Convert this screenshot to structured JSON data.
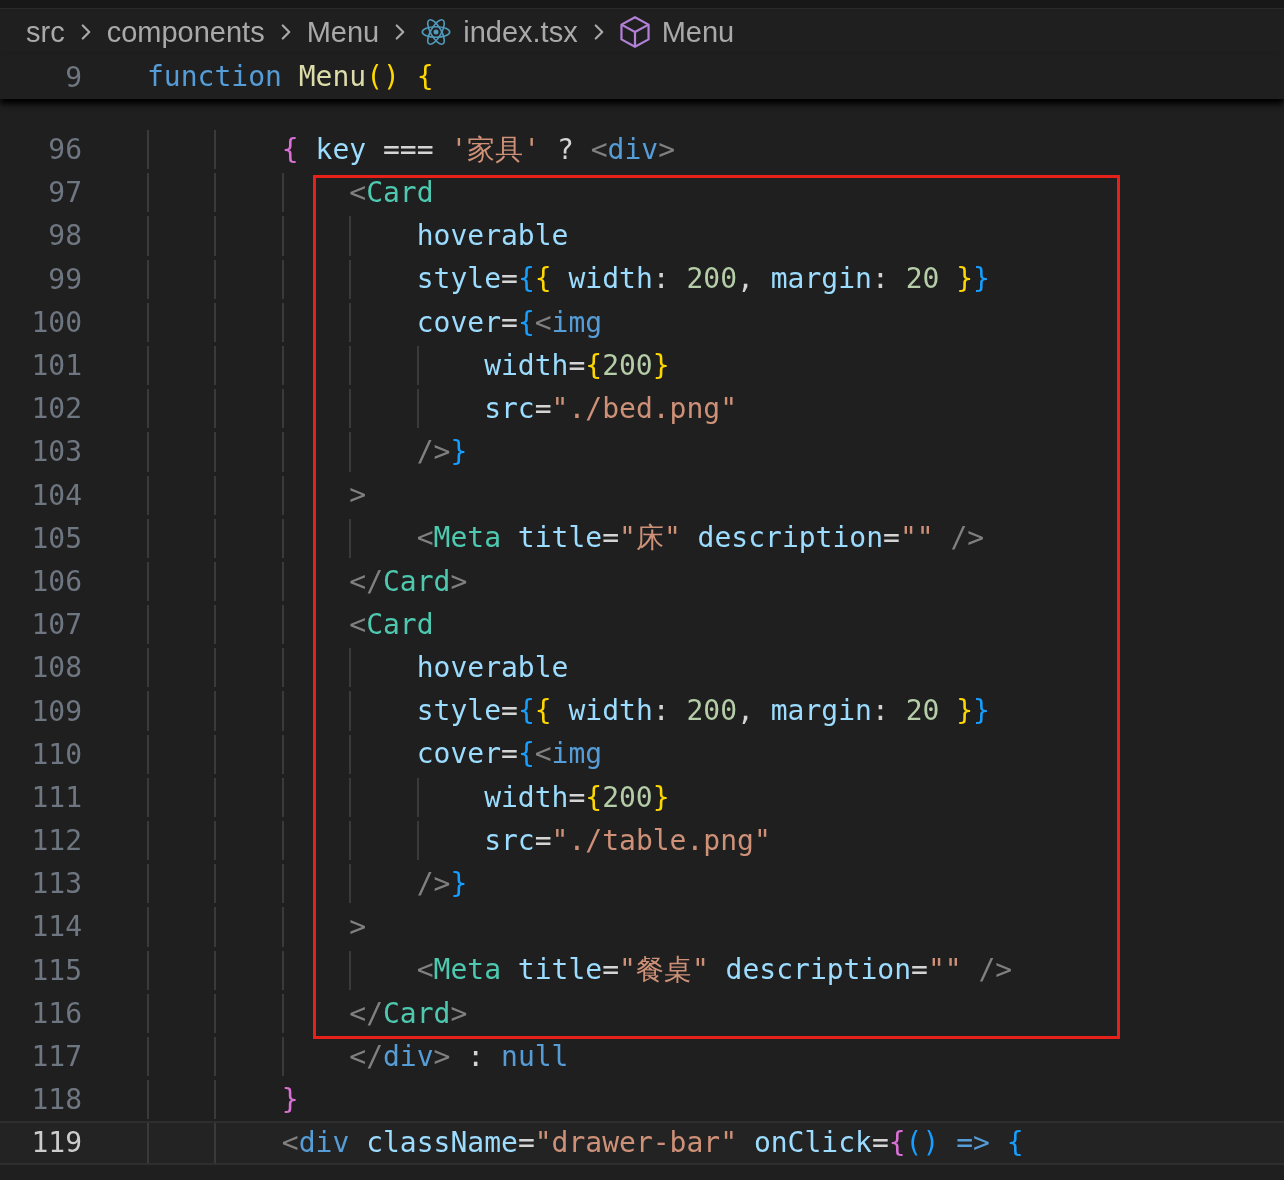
{
  "breadcrumb": [
    {
      "label": "src",
      "kind": "folder"
    },
    {
      "label": "components",
      "kind": "folder"
    },
    {
      "label": "Menu",
      "kind": "folder"
    },
    {
      "label": "index.tsx",
      "kind": "react-file"
    },
    {
      "label": "Menu",
      "kind": "symbol"
    }
  ],
  "sticky_line": {
    "number": "9",
    "tokens": [
      {
        "kind": "kw",
        "text": "function "
      },
      {
        "kind": "fn",
        "text": "Menu"
      },
      {
        "kind": "b1",
        "text": "() {"
      }
    ]
  },
  "lines_before": [
    {
      "number": "96",
      "current": false,
      "tokens": [
        {
          "kind": "b2",
          "text": "        { "
        },
        {
          "kind": "var",
          "text": "key"
        },
        {
          "kind": "op",
          "text": " === "
        },
        {
          "kind": "str",
          "text": "'家具'"
        },
        {
          "kind": "op",
          "text": " ? "
        },
        {
          "kind": "tp",
          "text": "<"
        },
        {
          "kind": "tag",
          "text": "div"
        },
        {
          "kind": "tp",
          "text": ">"
        }
      ]
    }
  ],
  "highlight_frame": {
    "lines": [
      {
        "number": "97",
        "current": false,
        "tokens": [
          {
            "kind": "tp",
            "text": "            <"
          },
          {
            "kind": "comp",
            "text": "Card"
          }
        ]
      },
      {
        "number": "98",
        "current": false,
        "tokens": [
          {
            "kind": "var",
            "text": "                hoverable"
          }
        ]
      },
      {
        "number": "99",
        "current": false,
        "tokens": [
          {
            "kind": "var",
            "text": "                style"
          },
          {
            "kind": "op",
            "text": "="
          },
          {
            "kind": "b3",
            "text": "{"
          },
          {
            "kind": "b1",
            "text": "{ "
          },
          {
            "kind": "var",
            "text": "width"
          },
          {
            "kind": "op",
            "text": ": "
          },
          {
            "kind": "num",
            "text": "200"
          },
          {
            "kind": "op",
            "text": ", "
          },
          {
            "kind": "var",
            "text": "margin"
          },
          {
            "kind": "op",
            "text": ": "
          },
          {
            "kind": "num",
            "text": "20"
          },
          {
            "kind": "b1",
            "text": " }"
          },
          {
            "kind": "b3",
            "text": "}"
          }
        ]
      },
      {
        "number": "100",
        "current": false,
        "tokens": [
          {
            "kind": "var",
            "text": "                cover"
          },
          {
            "kind": "op",
            "text": "="
          },
          {
            "kind": "b3",
            "text": "{"
          },
          {
            "kind": "tp",
            "text": "<"
          },
          {
            "kind": "tag",
            "text": "img"
          }
        ]
      },
      {
        "number": "101",
        "current": false,
        "tokens": [
          {
            "kind": "var",
            "text": "                    width"
          },
          {
            "kind": "op",
            "text": "="
          },
          {
            "kind": "b1",
            "text": "{"
          },
          {
            "kind": "num",
            "text": "200"
          },
          {
            "kind": "b1",
            "text": "}"
          }
        ]
      },
      {
        "number": "102",
        "current": false,
        "tokens": [
          {
            "kind": "var",
            "text": "                    src"
          },
          {
            "kind": "op",
            "text": "="
          },
          {
            "kind": "str",
            "text": "\"./bed.png\""
          }
        ]
      },
      {
        "number": "103",
        "current": false,
        "tokens": [
          {
            "kind": "tp",
            "text": "                />"
          },
          {
            "kind": "b3",
            "text": "}"
          }
        ]
      },
      {
        "number": "104",
        "current": false,
        "tokens": [
          {
            "kind": "tp",
            "text": "            >"
          }
        ]
      },
      {
        "number": "105",
        "current": false,
        "tokens": [
          {
            "kind": "tp",
            "text": "                <"
          },
          {
            "kind": "comp",
            "text": "Meta"
          },
          {
            "kind": "var",
            "text": " title"
          },
          {
            "kind": "op",
            "text": "="
          },
          {
            "kind": "str",
            "text": "\"床\""
          },
          {
            "kind": "var",
            "text": " description"
          },
          {
            "kind": "op",
            "text": "="
          },
          {
            "kind": "str",
            "text": "\"\""
          },
          {
            "kind": "tp",
            "text": " />"
          }
        ]
      },
      {
        "number": "106",
        "current": false,
        "tokens": [
          {
            "kind": "tp",
            "text": "            </"
          },
          {
            "kind": "comp",
            "text": "Card"
          },
          {
            "kind": "tp",
            "text": ">"
          }
        ]
      },
      {
        "number": "107",
        "current": false,
        "tokens": [
          {
            "kind": "tp",
            "text": "            <"
          },
          {
            "kind": "comp",
            "text": "Card"
          }
        ]
      },
      {
        "number": "108",
        "current": false,
        "tokens": [
          {
            "kind": "var",
            "text": "                hoverable"
          }
        ]
      },
      {
        "number": "109",
        "current": false,
        "tokens": [
          {
            "kind": "var",
            "text": "                style"
          },
          {
            "kind": "op",
            "text": "="
          },
          {
            "kind": "b3",
            "text": "{"
          },
          {
            "kind": "b1",
            "text": "{ "
          },
          {
            "kind": "var",
            "text": "width"
          },
          {
            "kind": "op",
            "text": ": "
          },
          {
            "kind": "num",
            "text": "200"
          },
          {
            "kind": "op",
            "text": ", "
          },
          {
            "kind": "var",
            "text": "margin"
          },
          {
            "kind": "op",
            "text": ": "
          },
          {
            "kind": "num",
            "text": "20"
          },
          {
            "kind": "b1",
            "text": " }"
          },
          {
            "kind": "b3",
            "text": "}"
          }
        ]
      },
      {
        "number": "110",
        "current": false,
        "tokens": [
          {
            "kind": "var",
            "text": "                cover"
          },
          {
            "kind": "op",
            "text": "="
          },
          {
            "kind": "b3",
            "text": "{"
          },
          {
            "kind": "tp",
            "text": "<"
          },
          {
            "kind": "tag",
            "text": "img"
          }
        ]
      },
      {
        "number": "111",
        "current": false,
        "tokens": [
          {
            "kind": "var",
            "text": "                    width"
          },
          {
            "kind": "op",
            "text": "="
          },
          {
            "kind": "b1",
            "text": "{"
          },
          {
            "kind": "num",
            "text": "200"
          },
          {
            "kind": "b1",
            "text": "}"
          }
        ]
      },
      {
        "number": "112",
        "current": false,
        "tokens": [
          {
            "kind": "var",
            "text": "                    src"
          },
          {
            "kind": "op",
            "text": "="
          },
          {
            "kind": "str",
            "text": "\"./table.png\""
          }
        ]
      },
      {
        "number": "113",
        "current": false,
        "tokens": [
          {
            "kind": "tp",
            "text": "                />"
          },
          {
            "kind": "b3",
            "text": "}"
          }
        ]
      },
      {
        "number": "114",
        "current": false,
        "tokens": [
          {
            "kind": "tp",
            "text": "            >"
          }
        ]
      },
      {
        "number": "115",
        "current": false,
        "tokens": [
          {
            "kind": "tp",
            "text": "                <"
          },
          {
            "kind": "comp",
            "text": "Meta"
          },
          {
            "kind": "var",
            "text": " title"
          },
          {
            "kind": "op",
            "text": "="
          },
          {
            "kind": "str",
            "text": "\"餐桌\""
          },
          {
            "kind": "var",
            "text": " description"
          },
          {
            "kind": "op",
            "text": "="
          },
          {
            "kind": "str",
            "text": "\"\""
          },
          {
            "kind": "tp",
            "text": " />"
          }
        ]
      },
      {
        "number": "116",
        "current": false,
        "tokens": [
          {
            "kind": "tp",
            "text": "            </"
          },
          {
            "kind": "comp",
            "text": "Card"
          },
          {
            "kind": "tp",
            "text": ">"
          }
        ]
      }
    ]
  },
  "lines_after": [
    {
      "number": "117",
      "current": false,
      "tokens": [
        {
          "kind": "tp",
          "text": "            </"
        },
        {
          "kind": "tag",
          "text": "div"
        },
        {
          "kind": "tp",
          "text": ">"
        },
        {
          "kind": "op",
          "text": " : "
        },
        {
          "kind": "kw",
          "text": "null"
        }
      ]
    },
    {
      "number": "118",
      "current": false,
      "tokens": [
        {
          "kind": "b2",
          "text": "        }"
        }
      ]
    },
    {
      "number": "119",
      "current": true,
      "tokens": [
        {
          "kind": "tp",
          "text": "        <"
        },
        {
          "kind": "tag",
          "text": "div"
        },
        {
          "kind": "var",
          "text": " className"
        },
        {
          "kind": "op",
          "text": "="
        },
        {
          "kind": "str",
          "text": "\"drawer-bar\""
        },
        {
          "kind": "var",
          "text": " onClick"
        },
        {
          "kind": "op",
          "text": "="
        },
        {
          "kind": "b2",
          "text": "{"
        },
        {
          "kind": "b3",
          "text": "() "
        },
        {
          "kind": "kw",
          "text": "=>"
        },
        {
          "kind": "b3",
          "text": " {"
        }
      ]
    }
  ]
}
